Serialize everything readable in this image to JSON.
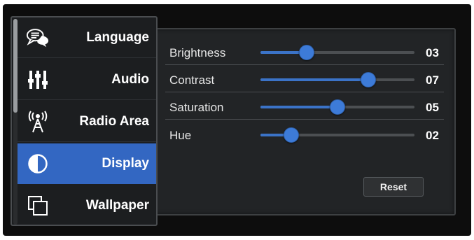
{
  "menu": {
    "items": [
      {
        "label": "Language",
        "icon": "speech-bubbles-icon",
        "active": false
      },
      {
        "label": "Audio",
        "icon": "equalizer-sliders-icon",
        "active": false
      },
      {
        "label": "Radio Area",
        "icon": "radio-tower-icon",
        "active": false
      },
      {
        "label": "Display",
        "icon": "contrast-half-circle-icon",
        "active": true
      },
      {
        "label": "Wallpaper",
        "icon": "stacked-squares-icon",
        "active": false
      }
    ]
  },
  "settings": [
    {
      "label": "Brightness",
      "value": "03",
      "level": 0.3
    },
    {
      "label": "Contrast",
      "value": "07",
      "level": 0.7
    },
    {
      "label": "Saturation",
      "value": "05",
      "level": 0.5
    },
    {
      "label": "Hue",
      "value": "02",
      "level": 0.2
    }
  ],
  "reset_label": "Reset",
  "colors": {
    "accent": "#3367c2",
    "knob": "#3d7bd8",
    "background": "#0d0d0d",
    "panel": "#222426"
  }
}
